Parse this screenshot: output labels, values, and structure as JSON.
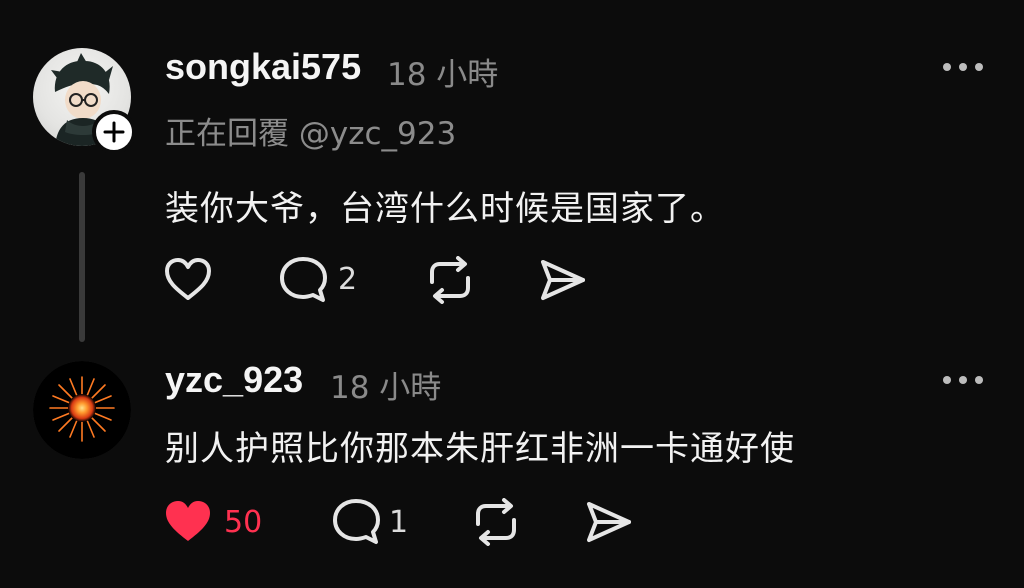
{
  "comments": [
    {
      "username": "songkai575",
      "time": "18 小時",
      "reply_to": "正在回覆 @yzc_923",
      "text": "装你大爷，台湾什么时候是国家了。",
      "likes": "",
      "reply_count": "2",
      "liked": false,
      "avatar_icon": "cartoon-boy-avatar-icon"
    },
    {
      "username": "yzc_923",
      "time": "18 小時",
      "text": "别人护照比你那本朱肝红非洲一卡通好使",
      "likes": "50",
      "reply_count": "1",
      "liked": true,
      "avatar_icon": "firework-avatar-icon"
    }
  ],
  "icons": {
    "like": "heart-icon",
    "comment": "comment-bubble-icon",
    "repost": "repost-icon",
    "share": "send-icon",
    "more": "more-dots-icon",
    "add": "plus-icon"
  },
  "colors": {
    "background": "#0c0c0c",
    "liked": "#ff3150",
    "text_primary": "#f3f3f3",
    "text_secondary": "#8a8a8a"
  }
}
